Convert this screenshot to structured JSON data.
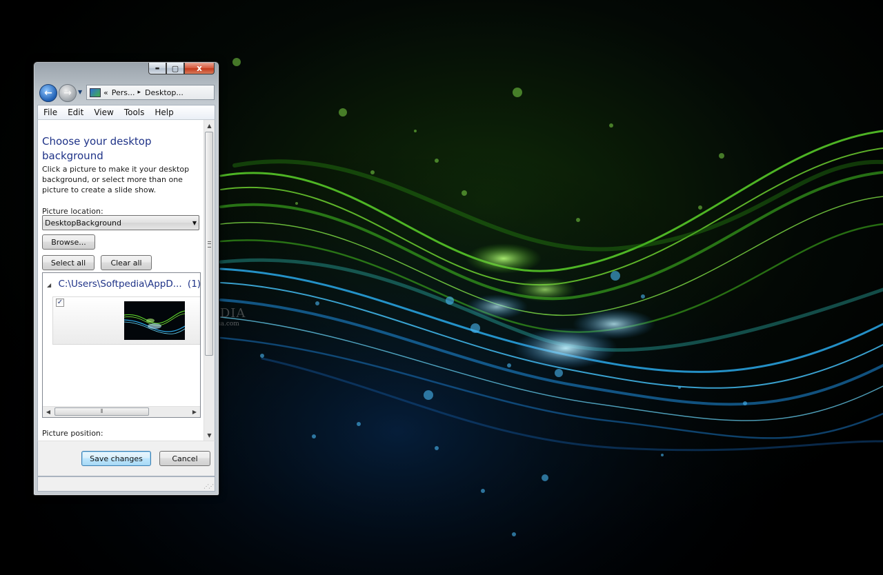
{
  "window": {
    "caption_buttons": {
      "minimize": "▬",
      "maximize": "▢",
      "close": "x"
    },
    "address_bar": {
      "overflow": "«",
      "crumb_1": "Pers...",
      "separator": "▸",
      "crumb_2": "Desktop..."
    },
    "menu": [
      "File",
      "Edit",
      "View",
      "Tools",
      "Help"
    ],
    "heading": "Choose your desktop background",
    "description": "Click a picture to make it your desktop background, or select more than one picture to create a slide show.",
    "picture_location_label": "Picture location:",
    "picture_location_value": "DesktopBackground",
    "browse_label": "Browse...",
    "select_all_label": "Select all",
    "clear_all_label": "Clear all",
    "group": {
      "path": "C:\\Users\\Softpedia\\AppD...",
      "count": "(1)"
    },
    "thumbnail_checked": true,
    "picture_position_label": "Picture position:",
    "save_label": "Save changes",
    "cancel_label": "Cancel"
  },
  "watermark": {
    "brand": "SOFTPEDIA",
    "url": "www.softpedia.com"
  },
  "icons": [
    "back-arrow-icon",
    "forward-arrow-icon",
    "nav-dropdown-icon",
    "control-panel-icon",
    "breadcrumb-chevron-icon",
    "dropdown-arrow-icon",
    "expand-triangle-icon",
    "checkmark-icon",
    "scroll-up-icon",
    "scroll-down-icon",
    "scroll-left-icon",
    "scroll-right-icon",
    "resize-grip-icon"
  ],
  "colors": {
    "heading_blue": "#1e3287",
    "wallpaper_green": "#6ee12a",
    "wallpaper_blue": "#2aa8e8"
  }
}
